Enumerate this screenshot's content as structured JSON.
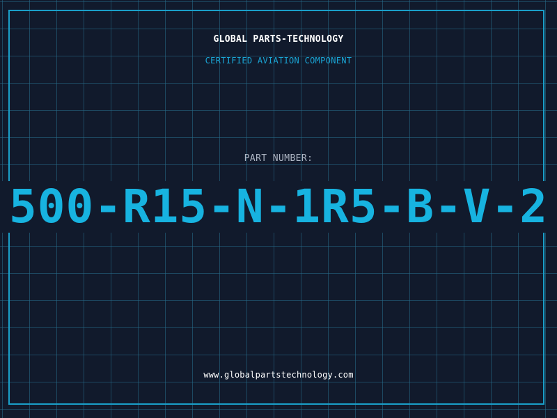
{
  "header": {
    "brand": "GLOBAL PARTS-TECHNOLOGY",
    "subtitle": "CERTIFIED AVIATION COMPONENT"
  },
  "part": {
    "label": "PART NUMBER:",
    "number": "500-R15-N-1R5-B-V-2"
  },
  "footer": {
    "website": "www.globalpartstechnology.com"
  },
  "colors": {
    "background": "#111a2c",
    "grid": "#266e8c",
    "frame": "#1a9fc9",
    "accent": "#17b3e0",
    "label": "#aeb6c4",
    "text": "#ffffff"
  }
}
